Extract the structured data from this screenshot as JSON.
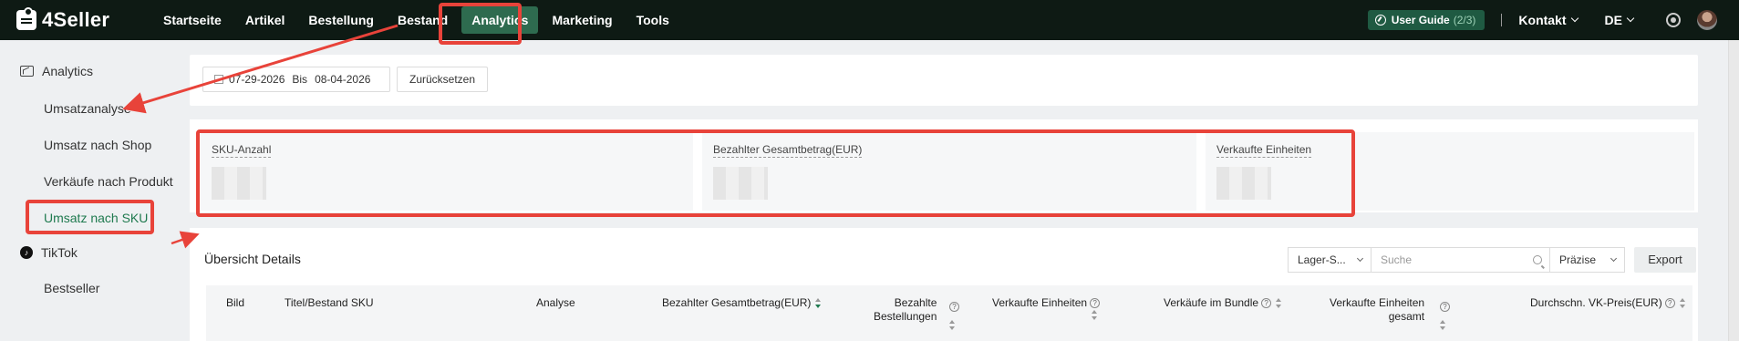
{
  "brand": "4Seller",
  "nav": {
    "items": [
      "Startseite",
      "Artikel",
      "Bestellung",
      "Bestand",
      "Analytics",
      "Marketing",
      "Tools"
    ],
    "active_index": 4,
    "guide_label": "User Guide",
    "guide_count": "(2/3)",
    "contact": "Kontakt",
    "language": "DE"
  },
  "sidebar": {
    "group1": "Analytics",
    "items": [
      "Umsatzanalyse",
      "Umsatz nach Shop",
      "Verkäufe nach Produkt",
      "Umsatz nach SKU"
    ],
    "active_index": 3,
    "group2": "TikTok",
    "tiktok_items": [
      "Bestseller"
    ]
  },
  "filter": {
    "date_from": "07-29-2026",
    "separator": "Bis",
    "date_to": "08-04-2026",
    "reset": "Zurücksetzen"
  },
  "stats": [
    {
      "label": "SKU-Anzahl"
    },
    {
      "label": "Bezahlter Gesamtbetrag(EUR)"
    },
    {
      "label": "Verkaufte Einheiten"
    }
  ],
  "details": {
    "title": "Übersicht Details",
    "type_select": "Lager-S...",
    "search_placeholder": "Suche",
    "mode_select": "Präzise",
    "export": "Export"
  },
  "columns": {
    "bild": "Bild",
    "titel": "Titel/Bestand SKU",
    "analyse": "Analyse",
    "gesamtbetrag": "Bezahlter Gesamtbetrag(EUR)",
    "bestellungen_l1": "Bezahlte",
    "bestellungen_l2": "Bestellungen",
    "einheiten": "Verkaufte Einheiten",
    "bundle": "Verkäufe im Bundle",
    "einheiten_gesamt_l1": "Verkaufte Einheiten",
    "einheiten_gesamt_l2": "gesamt",
    "vk_preis": "Durchschn. VK-Preis(EUR)"
  },
  "colors": {
    "nav_bg": "#0e1a14",
    "active_green": "#2e6b4f",
    "accent_green": "#1f7a4f",
    "annotation_red": "#e8433a"
  }
}
